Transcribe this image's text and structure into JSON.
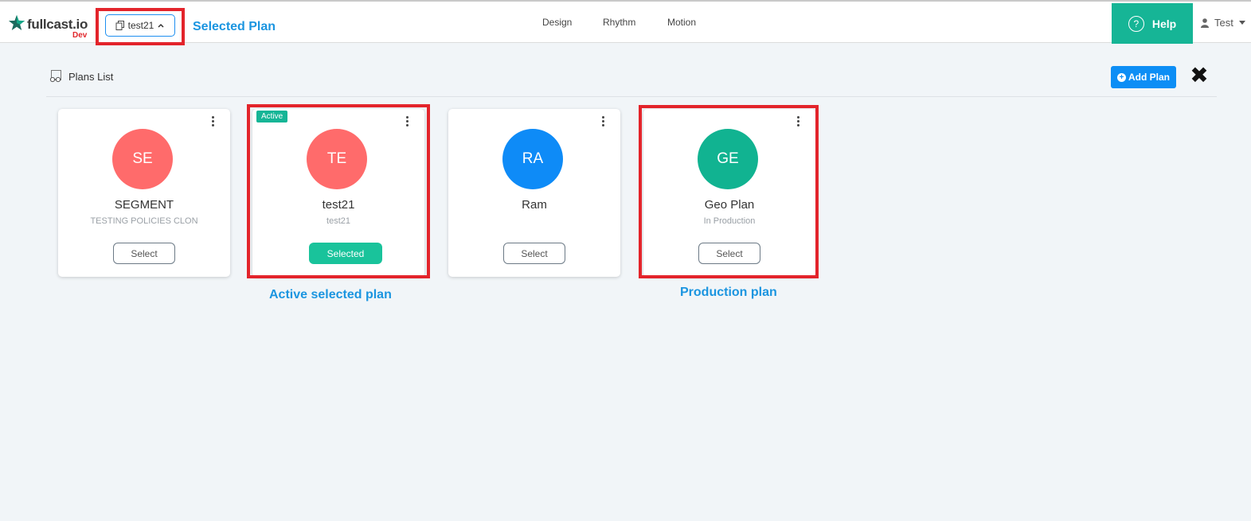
{
  "app": {
    "logo_text": "fullcast.io",
    "logo_env": "Dev"
  },
  "plan_switcher": {
    "label": "test21"
  },
  "nav": [
    {
      "label": "Design"
    },
    {
      "label": "Rhythm"
    },
    {
      "label": "Motion"
    }
  ],
  "help": {
    "label": "Help",
    "icon": "?"
  },
  "user": {
    "name": "Test"
  },
  "page": {
    "title": "Plans List",
    "add_plan_label": "Add Plan"
  },
  "cards": [
    {
      "initials": "SE",
      "name": "SEGMENT",
      "subtitle": "TESTING POLICIES CLON",
      "button": "Select",
      "color": "#ff6b6b",
      "active": false,
      "selected": false
    },
    {
      "initials": "TE",
      "name": "test21",
      "subtitle": "test21",
      "button": "Selected",
      "color": "#ff6b6b",
      "active": true,
      "active_label": "Active",
      "selected": true
    },
    {
      "initials": "RA",
      "name": "Ram",
      "subtitle": "",
      "button": "Select",
      "color": "#0e8bf7",
      "active": false,
      "selected": false
    },
    {
      "initials": "GE",
      "name": "Geo Plan",
      "subtitle": "In Production",
      "button": "Select",
      "color": "#11b391",
      "active": false,
      "selected": false
    }
  ],
  "annotations": {
    "selected_plan": "Selected Plan",
    "active_selected_plan": "Active selected plan",
    "production_plan": "Production plan"
  },
  "colors": {
    "accent_green": "#16b596",
    "accent_blue": "#0d8ef5",
    "annotation_red": "#e3242b",
    "annotation_blue": "#1b95e0"
  }
}
